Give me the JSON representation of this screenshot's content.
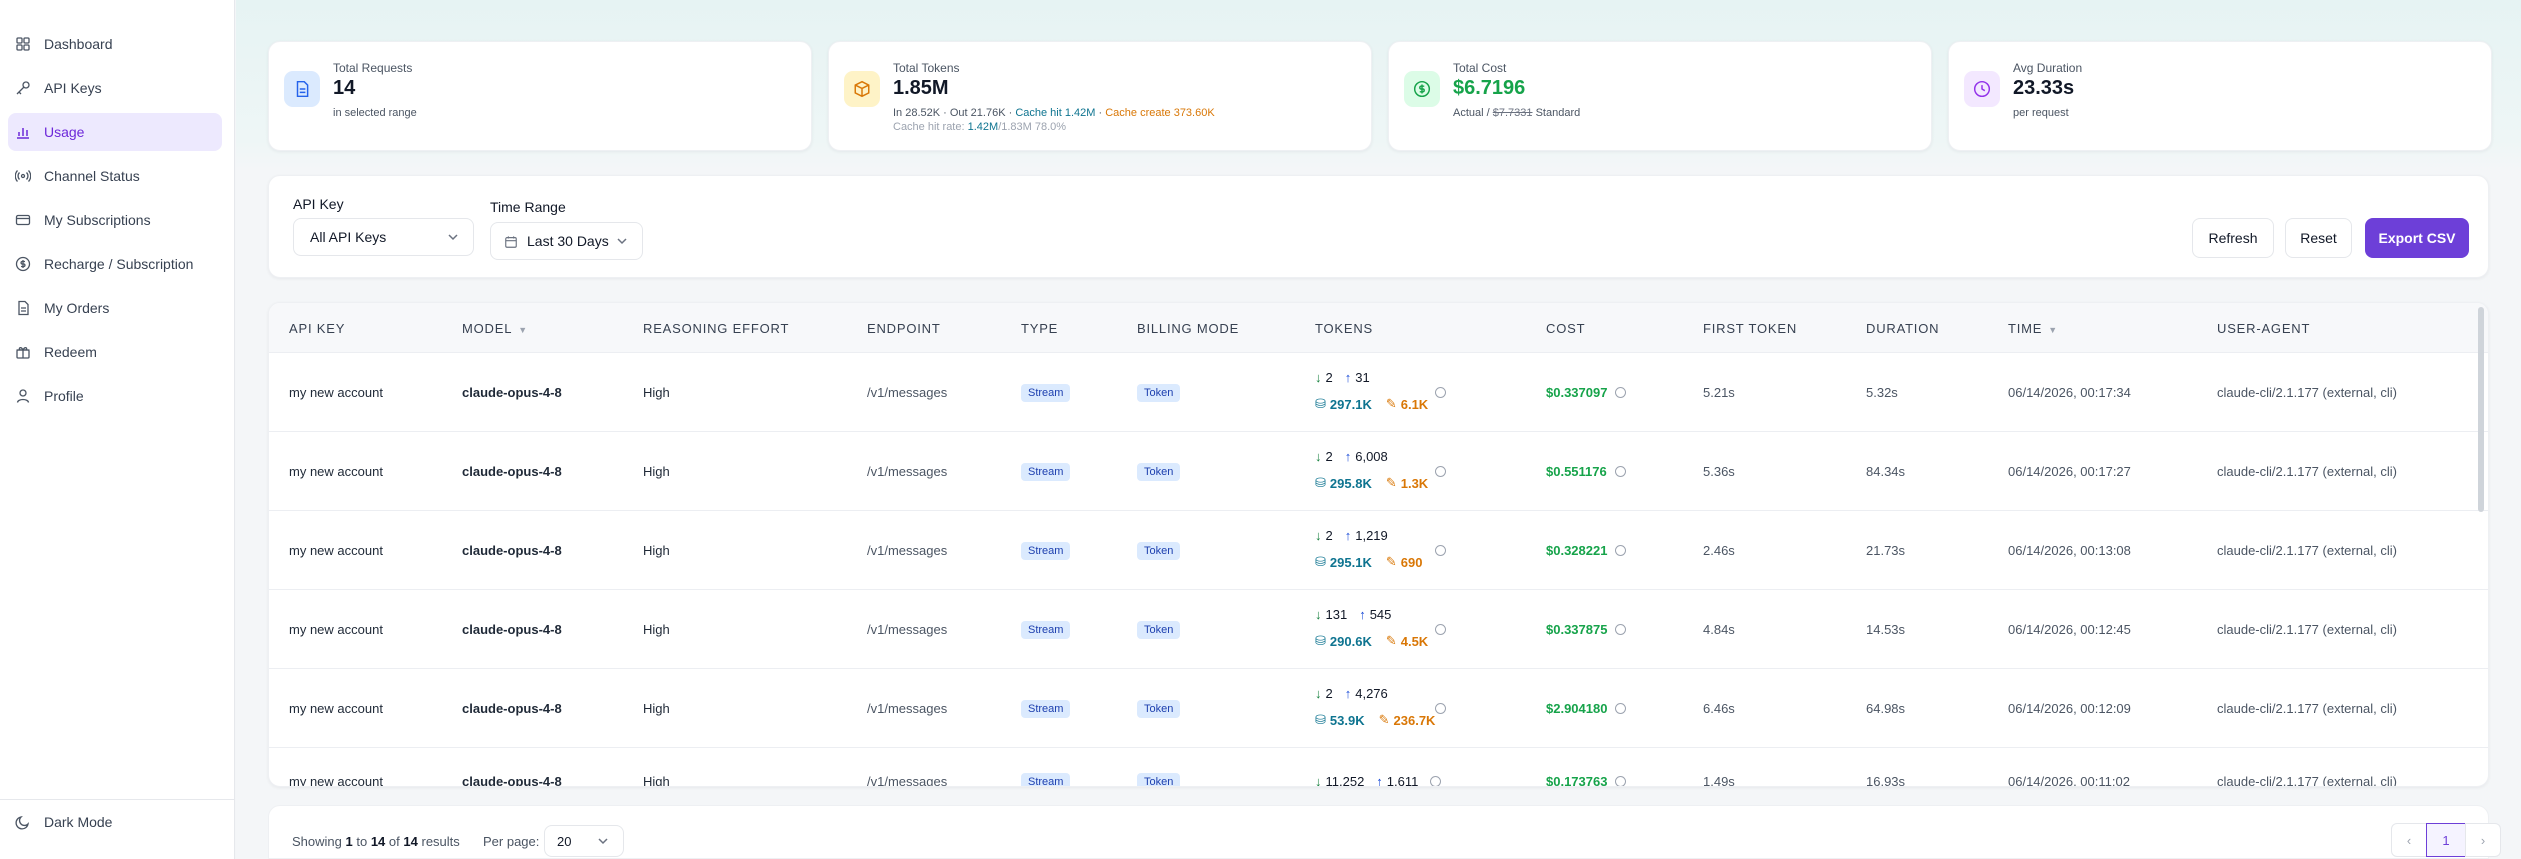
{
  "sidebar": {
    "items": [
      {
        "label": "Dashboard",
        "icon": "grid-icon"
      },
      {
        "label": "API Keys",
        "icon": "key-icon"
      },
      {
        "label": "Usage",
        "icon": "chart-icon"
      },
      {
        "label": "Channel Status",
        "icon": "broadcast-icon"
      },
      {
        "label": "My Subscriptions",
        "icon": "card-icon"
      },
      {
        "label": "Recharge / Subscription",
        "icon": "dollar-icon"
      },
      {
        "label": "My Orders",
        "icon": "document-icon"
      },
      {
        "label": "Redeem",
        "icon": "gift-icon"
      },
      {
        "label": "Profile",
        "icon": "user-icon"
      }
    ],
    "dark_mode_label": "Dark Mode"
  },
  "stats": {
    "requests": {
      "label": "Total Requests",
      "value": "14",
      "sub": "in selected range"
    },
    "tokens": {
      "label": "Total Tokens",
      "value": "1.85M",
      "in": "In 28.52K",
      "out": "· Out 21.76K ·",
      "cache_hit": "Cache hit 1.42M",
      "cache_sep": "·",
      "cache_create": "Cache create 373.60K",
      "rate_label": "Cache hit rate:",
      "rate_value": "1.42M",
      "rate_total": "/1.83M",
      "rate_pct": "78.0%"
    },
    "cost": {
      "label": "Total Cost",
      "value": "$6.7196",
      "actual": "Actual /",
      "standard_value": "$7.7331",
      "standard": "Standard"
    },
    "duration": {
      "label": "Avg Duration",
      "value": "23.33s",
      "sub": "per request"
    }
  },
  "filters": {
    "api_key_label": "API Key",
    "api_key_value": "All API Keys",
    "time_range_label": "Time Range",
    "time_range_value": "Last 30 Days",
    "refresh": "Refresh",
    "reset": "Reset",
    "export": "Export CSV"
  },
  "table": {
    "headers": [
      "API KEY",
      "MODEL",
      "REASONING EFFORT",
      "ENDPOINT",
      "TYPE",
      "BILLING MODE",
      "TOKENS",
      "COST",
      "FIRST TOKEN",
      "DURATION",
      "TIME",
      "USER-AGENT"
    ],
    "rows": [
      {
        "key": "my new account",
        "model": "claude-opus-4-8",
        "effort": "High",
        "endpoint": "/v1/messages",
        "type": "Stream",
        "billing": "Token",
        "in": "2",
        "out": "31",
        "read": "297.1K",
        "write": "6.1K",
        "cost": "$0.337097",
        "first": "5.21s",
        "duration": "5.32s",
        "time": "06/14/2026, 00:17:34",
        "ua": "claude-cli/2.1.177 (external, cli)"
      },
      {
        "key": "my new account",
        "model": "claude-opus-4-8",
        "effort": "High",
        "endpoint": "/v1/messages",
        "type": "Stream",
        "billing": "Token",
        "in": "2",
        "out": "6,008",
        "read": "295.8K",
        "write": "1.3K",
        "cost": "$0.551176",
        "first": "5.36s",
        "duration": "84.34s",
        "time": "06/14/2026, 00:17:27",
        "ua": "claude-cli/2.1.177 (external, cli)"
      },
      {
        "key": "my new account",
        "model": "claude-opus-4-8",
        "effort": "High",
        "endpoint": "/v1/messages",
        "type": "Stream",
        "billing": "Token",
        "in": "2",
        "out": "1,219",
        "read": "295.1K",
        "write": "690",
        "cost": "$0.328221",
        "first": "2.46s",
        "duration": "21.73s",
        "time": "06/14/2026, 00:13:08",
        "ua": "claude-cli/2.1.177 (external, cli)"
      },
      {
        "key": "my new account",
        "model": "claude-opus-4-8",
        "effort": "High",
        "endpoint": "/v1/messages",
        "type": "Stream",
        "billing": "Token",
        "in": "131",
        "out": "545",
        "read": "290.6K",
        "write": "4.5K",
        "cost": "$0.337875",
        "first": "4.84s",
        "duration": "14.53s",
        "time": "06/14/2026, 00:12:45",
        "ua": "claude-cli/2.1.177 (external, cli)"
      },
      {
        "key": "my new account",
        "model": "claude-opus-4-8",
        "effort": "High",
        "endpoint": "/v1/messages",
        "type": "Stream",
        "billing": "Token",
        "in": "2",
        "out": "4,276",
        "read": "53.9K",
        "write": "236.7K",
        "cost": "$2.904180",
        "first": "6.46s",
        "duration": "64.98s",
        "time": "06/14/2026, 00:12:09",
        "ua": "claude-cli/2.1.177 (external, cli)"
      },
      {
        "key": "my new account",
        "model": "claude-opus-4-8",
        "effort": "High",
        "endpoint": "/v1/messages",
        "type": "Stream",
        "billing": "Token",
        "in": "11,252",
        "out": "1,611",
        "read": "",
        "write": "",
        "cost": "$0.173763",
        "first": "1.49s",
        "duration": "16.93s",
        "time": "06/14/2026, 00:11:02",
        "ua": "claude-cli/2.1.177 (external, cli)"
      }
    ]
  },
  "footer": {
    "showing": "Showing",
    "from": "1",
    "to_label": "to",
    "to": "14",
    "of_label": "of",
    "total": "14",
    "results": "results",
    "per_page_label": "Per page:",
    "per_page_value": "20",
    "page": "1"
  },
  "colors": {
    "accent": "#6d3fd8",
    "cost": "#16a34a",
    "cache_read": "#0e7490",
    "cache_write": "#d97706"
  }
}
